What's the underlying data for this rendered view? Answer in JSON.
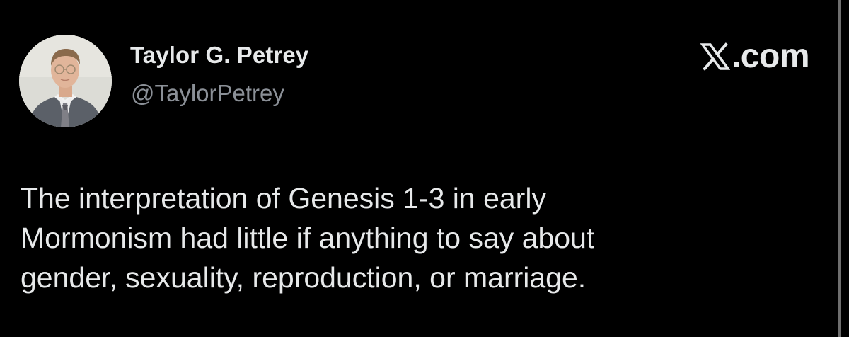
{
  "author": {
    "name": "Taylor G. Petrey",
    "handle": "@TaylorPetrey",
    "avatar_icon": "avatar-photo"
  },
  "site": {
    "domain": ".com",
    "logo_icon": "x-logo-icon"
  },
  "tweet": {
    "lines": [
      "The interpretation of Genesis 1-3 in early",
      "Mormonism had little if anything to say about",
      "gender, sexuality, reproduction, or marriage."
    ]
  },
  "colors": {
    "background": "#000000",
    "text": "#e7e9ea",
    "secondary_text": "#8b9097"
  }
}
